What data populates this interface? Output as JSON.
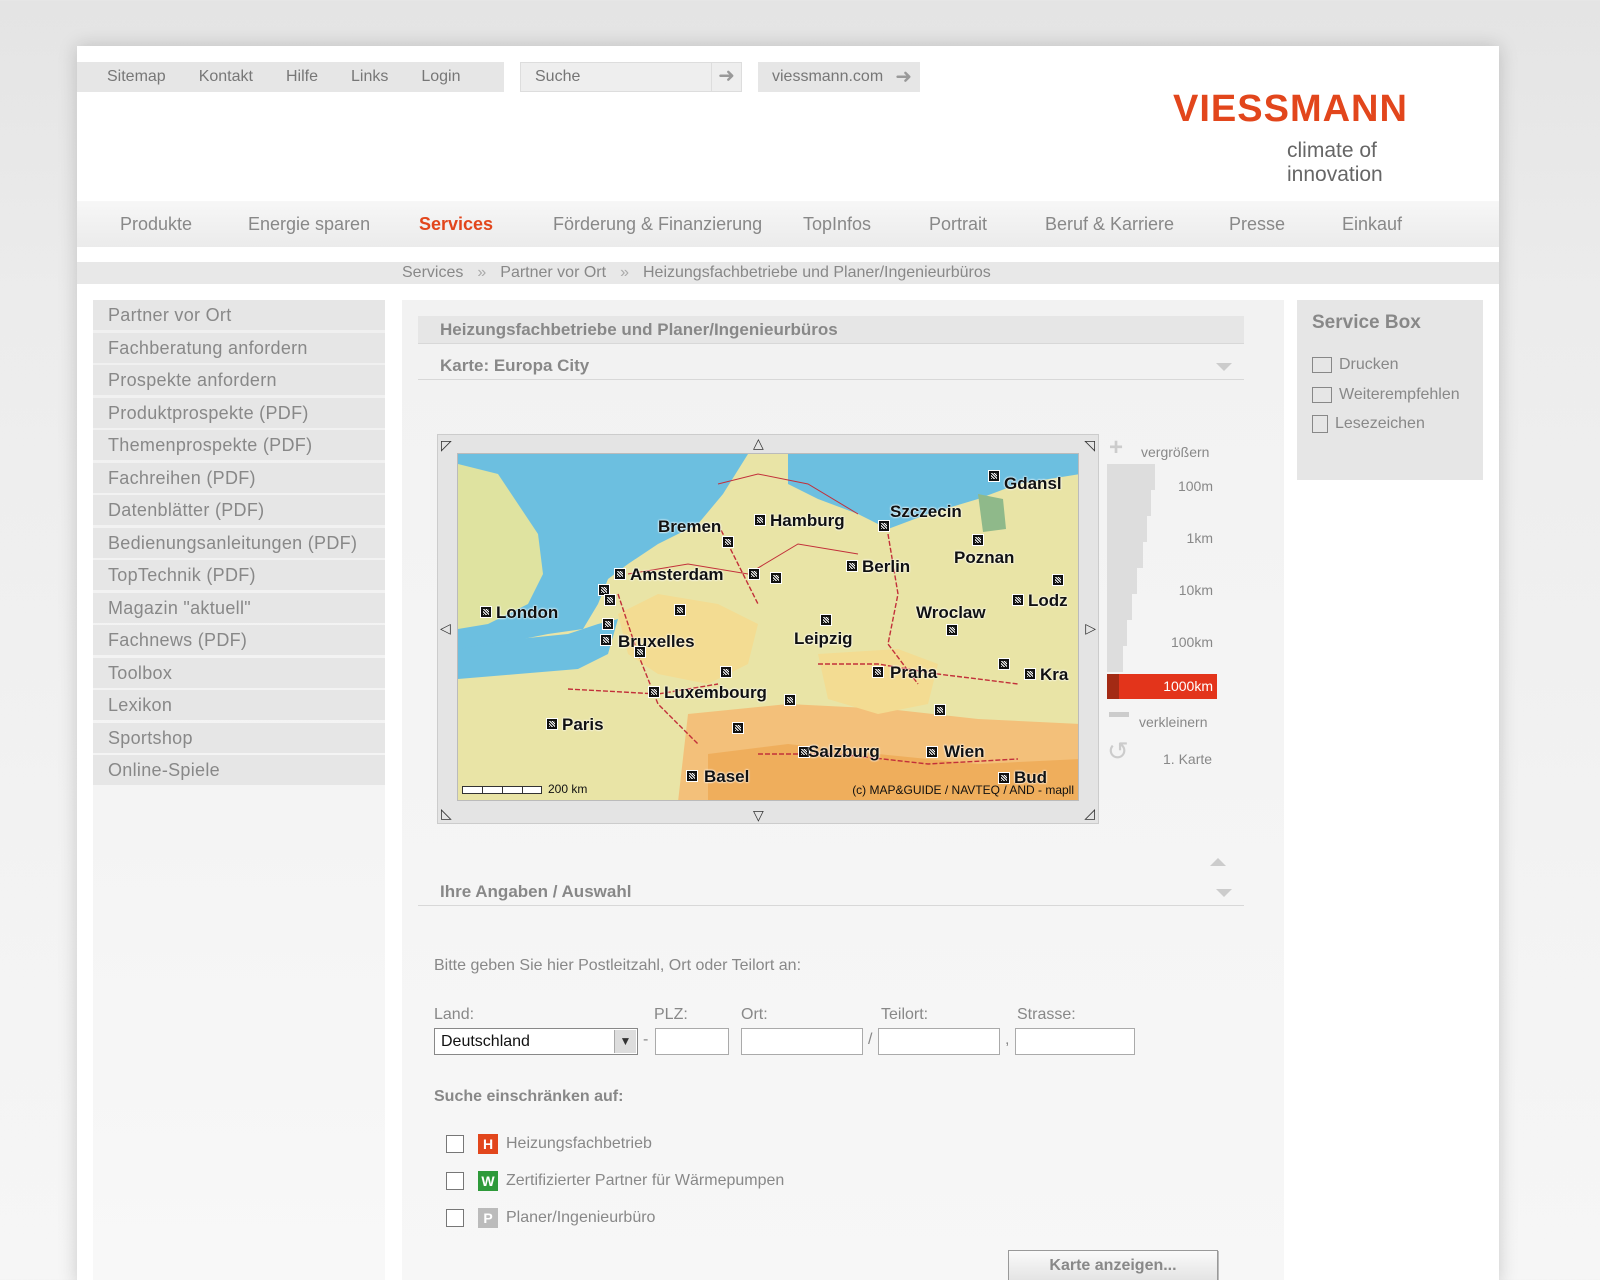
{
  "util": {
    "links": [
      "Sitemap",
      "Kontakt",
      "Hilfe",
      "Links",
      "Login"
    ],
    "search_placeholder": "Suche",
    "site_link": "viessmann.com"
  },
  "logo": {
    "brand": "VIESSMANN",
    "claim": "climate of innovation"
  },
  "nav": {
    "items": [
      "Produkte",
      "Energie sparen",
      "Services",
      "Förderung & Finanzierung",
      "TopInfos",
      "Portrait",
      "Beruf & Karriere",
      "Presse",
      "Einkauf"
    ],
    "active": "Services"
  },
  "breadcrumb": {
    "sep": "»",
    "items": [
      "Services",
      "Partner vor Ort",
      "Heizungsfachbetriebe und Planer/Ingenieurbüros"
    ]
  },
  "sidebar": {
    "items": [
      "Partner vor Ort",
      "Fachberatung anfordern",
      "Prospekte anfordern",
      "Produktprospekte (PDF)",
      "Themenprospekte (PDF)",
      "Fachreihen (PDF)",
      "Datenblätter (PDF)",
      "Bedienungsanleitungen (PDF)",
      "TopTechnik (PDF)",
      "Magazin \"aktuell\"",
      "Fachnews (PDF)",
      "Toolbox",
      "Lexikon",
      "Sportshop",
      "Online-Spiele"
    ]
  },
  "content": {
    "heading": "Heizungsfachbetriebe und Planer/Ingenieurbüros",
    "map_section": "Karte: Europa City",
    "map": {
      "cities": [
        "Gdansk",
        "Szczecin",
        "Hamburg",
        "Bremen",
        "Berlin",
        "Poznan",
        "Amsterdam",
        "Lodz",
        "London",
        "Wroclaw",
        "Bruxelles",
        "Leipzig",
        "Praha",
        "Krakow",
        "Luxembourg",
        "Paris",
        "Salzburg",
        "Wien",
        "Basel",
        "Budapest"
      ],
      "city_labels": [
        "Gdansl",
        "Szczecin",
        "Hamburg",
        "Bremen",
        "Berlin",
        "Poznan",
        "Amsterdam",
        "Lodz",
        "London",
        "Wroclaw",
        "Bruxelles",
        "Leipzig",
        "Praha",
        "Kra",
        "Luxembourg",
        "Paris",
        "Salzburg",
        "Wien",
        "Basel",
        "Bud"
      ],
      "scale": "200 km",
      "copyright": "(c) MAP&GUIDE / NAVTEQ / AND - mapll"
    },
    "zoom": {
      "zoom_in": "vergrößern",
      "zoom_out": "verkleinern",
      "reset": "1. Karte",
      "levels": [
        "100m",
        "1km",
        "10km",
        "100km",
        "1000km"
      ],
      "active_level": "1000km"
    },
    "form_section": "Ihre Angaben / Auswahl",
    "form": {
      "intro": "Bitte geben Sie hier Postleitzahl, Ort oder Teilort an:",
      "land_label": "Land:",
      "land_value": "Deutschland",
      "plz_label": "PLZ:",
      "ort_label": "Ort:",
      "teilort_label": "Teilort:",
      "strasse_label": "Strasse:",
      "plz_value": "",
      "ort_value": "",
      "teilort_value": "",
      "strasse_value": "",
      "restrict_label": "Suche einschränken auf:",
      "options": [
        {
          "badge": "H",
          "color": "#e2461c",
          "label": "Heizungsfachbetrieb",
          "checked": false
        },
        {
          "badge": "W",
          "color": "#2e9a3a",
          "label": "Zertifizierter Partner für Wärmepumpen",
          "checked": false
        },
        {
          "badge": "P",
          "color": "#bbbbbb",
          "label": "Planer/Ingenieurbüro",
          "checked": false
        }
      ],
      "submit": "Karte anzeigen..."
    }
  },
  "service_box": {
    "title": "Service Box",
    "links": [
      "Drucken",
      "Weiterempfehlen",
      "Lesezeichen"
    ]
  }
}
